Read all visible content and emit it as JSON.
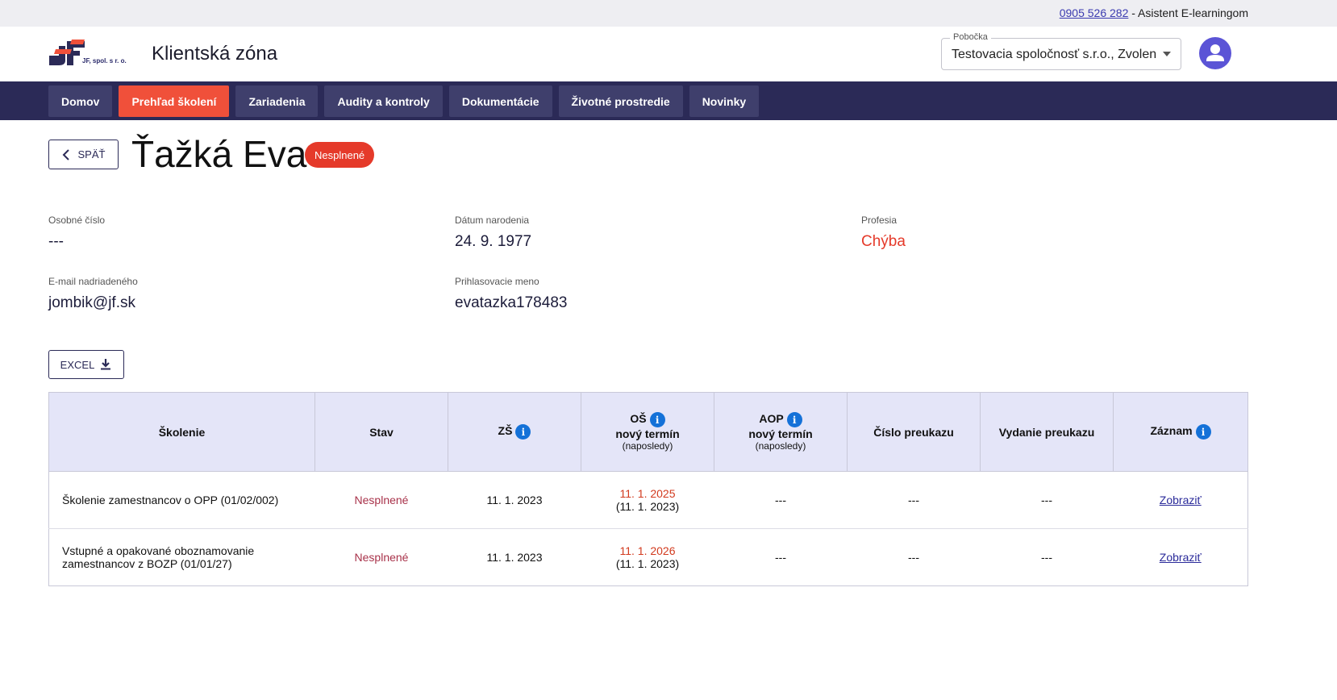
{
  "topbar": {
    "phone": "0905 526 282",
    "contact_text": " - Asistent E-learningom"
  },
  "header": {
    "logo_text": "JF, spol. s r. o.",
    "app_title": "Klientská zóna",
    "branch": {
      "label": "Pobočka",
      "value": "Testovacia spoločnosť s.r.o., Zvolen"
    }
  },
  "nav": {
    "items": [
      {
        "label": "Domov"
      },
      {
        "label": "Prehľad školení"
      },
      {
        "label": "Zariadenia"
      },
      {
        "label": "Audity a kontroly"
      },
      {
        "label": "Dokumentácie"
      },
      {
        "label": "Životné prostredie"
      },
      {
        "label": "Novinky"
      }
    ],
    "active_index": 1
  },
  "page": {
    "back_label": "SPÄŤ",
    "name": "Ťažká Eva",
    "status": "Nesplnené",
    "excel_label": "EXCEL"
  },
  "info": {
    "personal_number": {
      "label": "Osobné číslo",
      "value": "---"
    },
    "birth_date": {
      "label": "Dátum narodenia",
      "value": "24. 9. 1977"
    },
    "profession": {
      "label": "Profesia",
      "value": "Chýba"
    },
    "supervisor_email": {
      "label": "E-mail nadriadeného",
      "value": "jombik@jf.sk"
    },
    "login": {
      "label": "Prihlasovacie meno",
      "value": "evatazka178483"
    }
  },
  "table": {
    "headers": {
      "training": "Školenie",
      "status": "Stav",
      "zs": "ZŠ",
      "os": "OŠ",
      "os_sub1": "nový termín",
      "os_sub2": "(naposledy)",
      "aop": "AOP",
      "aop_sub1": "nový termín",
      "aop_sub2": "(naposledy)",
      "card_number": "Číslo preukazu",
      "card_issue": "Vydanie preukazu",
      "record": "Záznam"
    },
    "rows": [
      {
        "training": "Školenie zamestnancov o OPP (01/02/002)",
        "status": "Nesplnené",
        "zs": "11. 1. 2023",
        "os_new": "11. 1. 2025",
        "os_last": "(11. 1. 2023)",
        "aop": "---",
        "card_number": "---",
        "card_issue": "---",
        "record": "Zobraziť"
      },
      {
        "training": "Vstupné a opakované oboznamovanie zamestnancov z BOZP (01/01/27)",
        "status": "Nesplnené",
        "zs": "11. 1. 2023",
        "os_new": "11. 1. 2026",
        "os_last": "(11. 1. 2023)",
        "aop": "---",
        "card_number": "---",
        "card_issue": "---",
        "record": "Zobraziť"
      }
    ]
  },
  "colors": {
    "navbar": "#2b2a57",
    "active_tab": "#f0503a",
    "status_red": "#e53a2a",
    "header_table": "#e4e5f8",
    "info_icon": "#1471d8"
  },
  "icons": [
    "back-chevron-icon",
    "download-icon",
    "info-icon",
    "user-icon",
    "dropdown-caret-icon"
  ]
}
